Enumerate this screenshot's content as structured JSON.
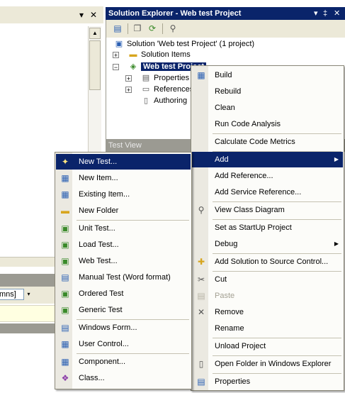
{
  "left_pane": {
    "combo_text": "mns]"
  },
  "solution_explorer": {
    "title": "Solution Explorer - Web test Project",
    "title_controls": [
      "▾",
      "‡",
      "✕"
    ],
    "tree": {
      "solution": "Solution 'Web test Project' (1 project)",
      "solution_items": "Solution Items",
      "project": "Web test Project",
      "properties": "Properties",
      "references": "References",
      "authoring": "Authoring"
    }
  },
  "test_view": {
    "label": "Test View"
  },
  "context_menu": {
    "items": [
      {
        "label": "Build",
        "icon": "build-icon"
      },
      {
        "label": "Rebuild"
      },
      {
        "label": "Clean"
      },
      {
        "label": "Run Code Analysis"
      },
      {
        "label": "Calculate Code Metrics"
      },
      {
        "label": "Add",
        "has_submenu": true,
        "highlighted": true
      },
      {
        "label": "Add Reference..."
      },
      {
        "label": "Add Service Reference..."
      },
      {
        "label": "View Class Diagram",
        "icon": "class-diagram-icon"
      },
      {
        "label": "Set as StartUp Project"
      },
      {
        "label": "Debug",
        "has_submenu": true
      },
      {
        "label": "Add Solution to Source Control...",
        "icon": "source-control-icon"
      },
      {
        "label": "Cut",
        "icon": "scissors-icon"
      },
      {
        "label": "Paste",
        "icon": "paste-icon",
        "disabled": true
      },
      {
        "label": "Remove",
        "icon": "remove-x-icon"
      },
      {
        "label": "Rename"
      },
      {
        "label": "Unload Project"
      },
      {
        "label": "Open Folder in Windows Explorer",
        "icon": "open-folder-icon"
      },
      {
        "label": "Properties",
        "icon": "properties-icon"
      }
    ]
  },
  "add_submenu": {
    "items": [
      {
        "label": "New Test...",
        "highlighted": true
      },
      {
        "label": "New Item..."
      },
      {
        "label": "Existing Item..."
      },
      {
        "label": "New Folder"
      },
      {
        "label": "Unit Test..."
      },
      {
        "label": "Load Test..."
      },
      {
        "label": "Web Test..."
      },
      {
        "label": "Manual Test (Word format)"
      },
      {
        "label": "Ordered Test"
      },
      {
        "label": "Generic Test"
      },
      {
        "label": "Windows Form..."
      },
      {
        "label": "User Control..."
      },
      {
        "label": "Component..."
      },
      {
        "label": "Class..."
      }
    ]
  },
  "colors": {
    "highlight": "#0a246a",
    "toolbar": "#ece9d8",
    "inactive_title": "#9b9a92"
  }
}
